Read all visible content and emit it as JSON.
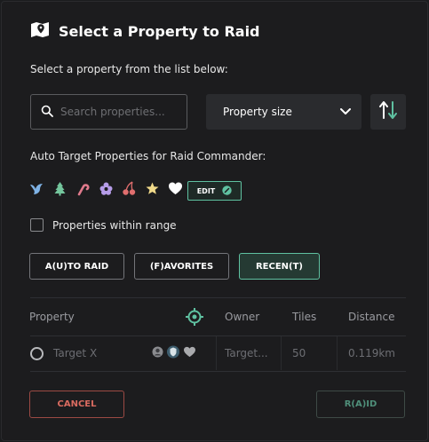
{
  "dialog": {
    "title": "Select a Property to Raid",
    "subtitle": "Select a property from the list below:"
  },
  "search": {
    "placeholder": "Search properties...",
    "value": ""
  },
  "sort": {
    "selected": "Property size"
  },
  "auto_target": {
    "label": "Auto Target Properties for Raid Commander:",
    "icons": [
      "bird-icon",
      "tree-icon",
      "candy-cane-icon",
      "flower-icon",
      "cherries-icon",
      "star-icon",
      "heart-icon"
    ],
    "icon_colors": [
      "#7fb3e6",
      "#74c69d",
      "#e07a8c",
      "#b59ce8",
      "#e06e6e",
      "#f0d98a",
      "#ffffff"
    ],
    "edit_label": "EDIT"
  },
  "range_filter": {
    "label": "Properties within range",
    "checked": false
  },
  "tabs": [
    {
      "label": "A(U)TO RAID",
      "active": false
    },
    {
      "label": "(F)AVORITES",
      "active": false
    },
    {
      "label": "RECEN(T)",
      "active": true
    }
  ],
  "table": {
    "columns": {
      "property": "Property",
      "owner": "Owner",
      "tiles": "Tiles",
      "distance": "Distance"
    },
    "rows": [
      {
        "property": "Target X",
        "owner": "Target...",
        "tiles": "50",
        "distance": "0.119km",
        "selected": false
      }
    ]
  },
  "actions": {
    "cancel": "CANCEL",
    "raid": "R(A)ID"
  },
  "colors": {
    "accent": "#5fc1a1",
    "danger": "#d96b60",
    "background": "#1c1c1e"
  }
}
